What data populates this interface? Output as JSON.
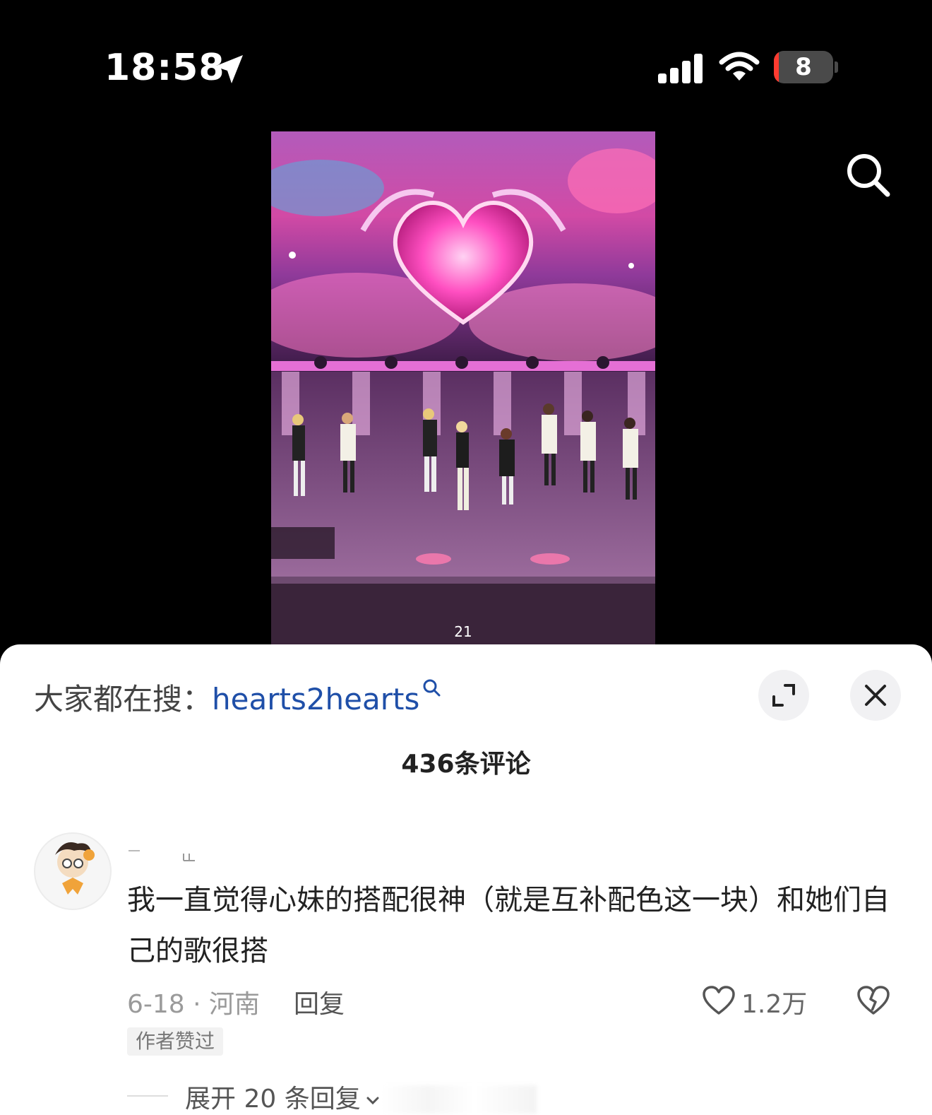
{
  "status_bar": {
    "time": "18:58",
    "battery_level": "8",
    "battery_fraction": 0.08
  },
  "video": {
    "counter": "21"
  },
  "sheet": {
    "hot_search_prefix": "大家都在搜：",
    "hot_search_term": "hearts2hearts",
    "comment_count": "436条评论"
  },
  "comment": {
    "text": "我一直觉得心妹的搭配很神（就是互补配色这一块）和她们自己的歌很搭",
    "date_location": "6-18 · 河南",
    "reply_label": "回复",
    "likes": "1.2万",
    "author_badge": "作者赞过",
    "expand_replies": "展开 20 条回复"
  },
  "colors": {
    "link_blue": "#1f4fa8",
    "battery_red": "#ff3b30",
    "sheet_bg": "#ffffff"
  },
  "icons": [
    "location-arrow-icon",
    "signal-icon",
    "wifi-icon",
    "battery-icon",
    "search-icon",
    "search-small-icon",
    "expand-icon",
    "close-icon",
    "heart-icon",
    "broken-heart-icon",
    "chevron-down-icon"
  ]
}
